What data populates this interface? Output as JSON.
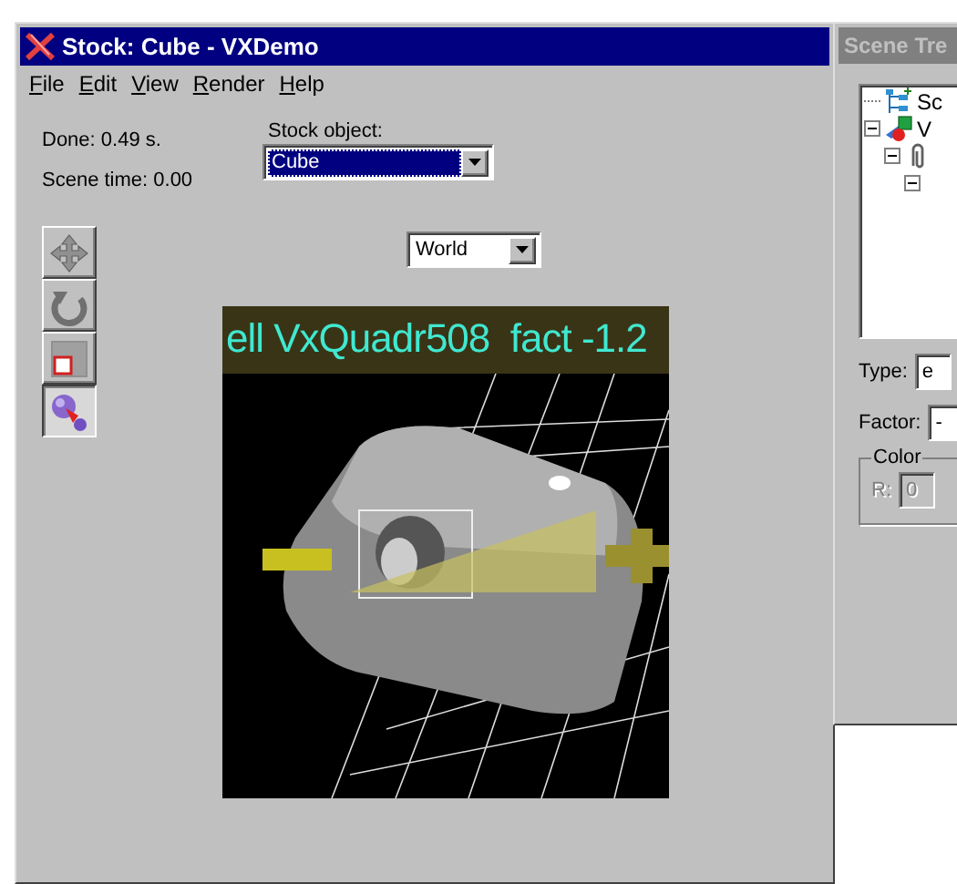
{
  "main_window": {
    "title": "Stock: Cube - VXDemo",
    "active": true
  },
  "menu": [
    {
      "label": "File"
    },
    {
      "label": "Edit"
    },
    {
      "label": "View"
    },
    {
      "label": "Render"
    },
    {
      "label": "Help"
    }
  ],
  "status": {
    "done": "Done: 0.49 s.",
    "scene_time": "Scene time: 0.00"
  },
  "stock_object": {
    "label": "Stock object:",
    "value": "Cube",
    "focused": true
  },
  "space_combo": {
    "value": "World"
  },
  "tools": [
    {
      "kind": "move",
      "selected": false
    },
    {
      "kind": "rotate",
      "selected": false
    },
    {
      "kind": "scale",
      "selected": false
    },
    {
      "kind": "deform",
      "selected": true
    }
  ],
  "viewport": {
    "overlay": "ell VxQuadr508  fact -1.2",
    "kind": "picture"
  },
  "scene_tree_window": {
    "title": "Scene Tre",
    "active": false,
    "tree": [
      {
        "kind": "scene",
        "label": "Sc"
      },
      {
        "kind": "object",
        "label": "V",
        "expanded": true,
        "children": [
          {
            "kind": "clip",
            "expanded": true,
            "children": [
              {
                "expanded": true
              }
            ]
          }
        ]
      }
    ],
    "type": {
      "label": "Type:",
      "value": "e"
    },
    "factor": {
      "label": "Factor:",
      "value": "-"
    },
    "color": {
      "legend": "Color",
      "r_label": "R:",
      "r_value": "0",
      "disabled": true
    }
  }
}
